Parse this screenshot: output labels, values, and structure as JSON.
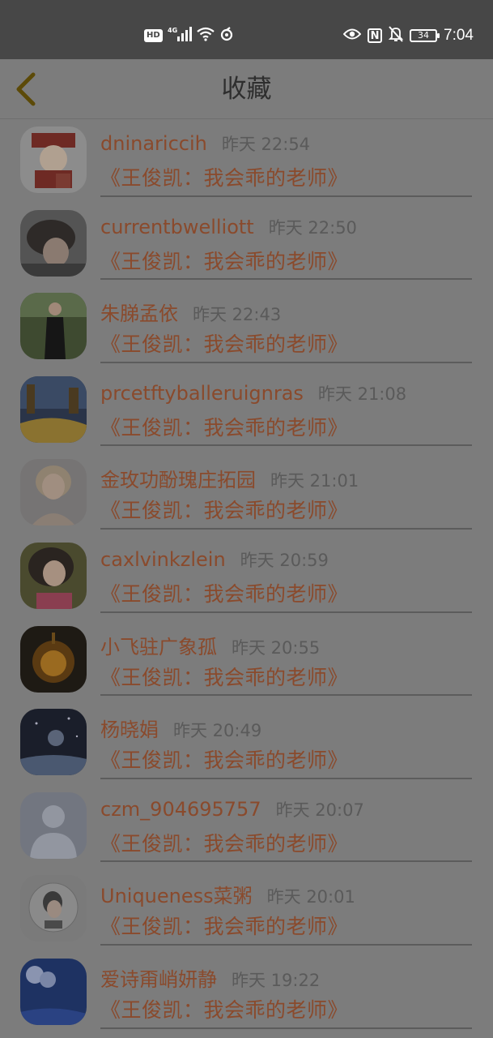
{
  "status_bar": {
    "network_label": "HD",
    "battery_level": "34",
    "time": "7:04",
    "icons": [
      "hd-icon",
      "signal-4g-icon",
      "wifi-icon",
      "data-saver-icon",
      "eye-icon",
      "nfc-icon",
      "bell-muted-icon",
      "battery-icon"
    ]
  },
  "header": {
    "title": "收藏",
    "back_icon": "chevron-left-icon",
    "accent_color": "#5c4a08"
  },
  "favorites": [
    {
      "user": "dninariccih",
      "time": "昨天 22:54",
      "title": "《王俊凯：我会乖的老师》"
    },
    {
      "user": "currentbwelliott",
      "time": "昨天 22:50",
      "title": "《王俊凯：我会乖的老师》"
    },
    {
      "user": "朱䏲孟依",
      "time": "昨天 22:43",
      "title": "《王俊凯：我会乖的老师》"
    },
    {
      "user": "prcetftyballeruignras",
      "time": "昨天 21:08",
      "title": "《王俊凯：我会乖的老师》"
    },
    {
      "user": "金玫功酚瑰庄拓园",
      "time": "昨天 21:01",
      "title": "《王俊凯：我会乖的老师》"
    },
    {
      "user": "caxlvinkzlein",
      "time": "昨天 20:59",
      "title": "《王俊凯：我会乖的老师》"
    },
    {
      "user": "小飞驻广象孤",
      "time": "昨天 20:55",
      "title": "《王俊凯：我会乖的老师》"
    },
    {
      "user": "杨晓娟",
      "time": "昨天 20:49",
      "title": "《王俊凯：我会乖的老师》"
    },
    {
      "user": "czm_904695757",
      "time": "昨天 20:07",
      "title": "《王俊凯：我会乖的老师》"
    },
    {
      "user": "Uniqueness菜粥",
      "time": "昨天 20:01",
      "title": "《王俊凯：我会乖的老师》"
    },
    {
      "user": "爱诗甭峭妍静",
      "time": "昨天 19:22",
      "title": "《王俊凯：我会乖的老师》"
    }
  ]
}
